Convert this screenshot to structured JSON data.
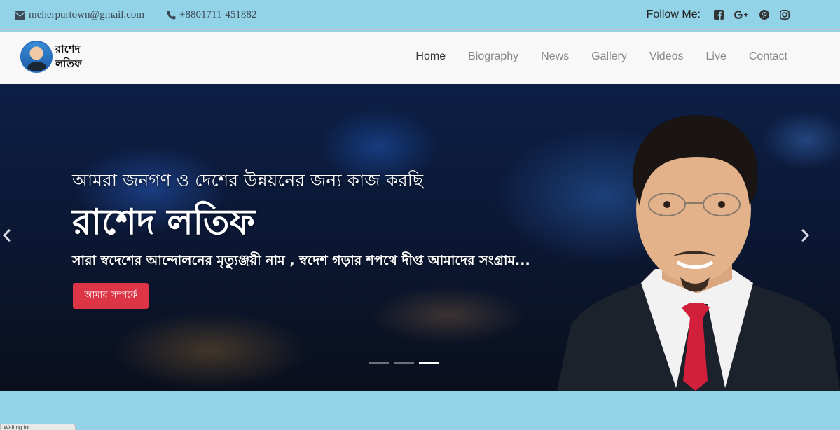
{
  "topbar": {
    "email": "meherpurtown@gmail.com",
    "phone": "+8801711-451882",
    "follow_label": "Follow Me:",
    "social_icons": [
      "facebook-icon",
      "google-plus-icon",
      "pinterest-icon",
      "instagram-icon"
    ]
  },
  "brand": {
    "line1": "রাশেদ",
    "line2": "লতিফ"
  },
  "nav": {
    "home": "Home",
    "biography": "Biography",
    "news": "News",
    "gallery": "Gallery",
    "videos": "Videos",
    "live": "Live",
    "contact": "Contact"
  },
  "hero": {
    "tagline": "আমরা জনগণ ও দেশের উন্নয়নের জন্য কাজ করছি",
    "name": "রাশেদ লতিফ",
    "subtitle": "সারা স্বদেশের আন্দোলনের মৃত্যুঞ্জয়ী নাম , স্বদেশ গড়ার শপথে দীপ্ত আমাদের সংগ্রাম...",
    "button": "আমার সম্পর্কে",
    "active_slide": 3,
    "slide_count": 3
  },
  "status_bar": {
    "text": "Waiting for …"
  },
  "colors": {
    "topbar": "#93d3e8",
    "navbar": "#f8f8f8",
    "cta": "#dc3545",
    "active_nav": "#333333",
    "nav": "#888888"
  }
}
